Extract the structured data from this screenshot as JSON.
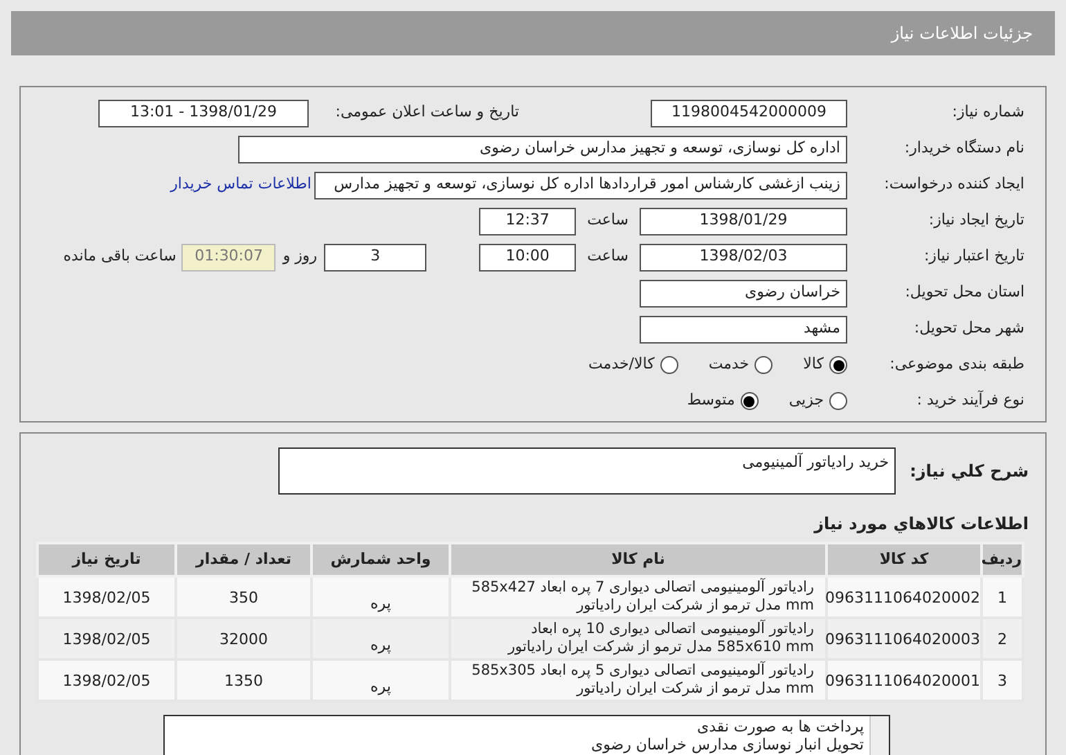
{
  "header": {
    "title": "جزئیات اطلاعات نیاز"
  },
  "need_number": {
    "label": "شماره نیاز:",
    "value": "1198004542000009"
  },
  "announce": {
    "label": "تاریخ و ساعت اعلان عمومی:",
    "value": "1398/01/29 - 13:01"
  },
  "buyer": {
    "label": "نام دستگاه خریدار:",
    "value": "اداره کل نوسازی، توسعه و تجهیز مدارس خراسان رضوی"
  },
  "creator": {
    "label": "ایجاد کننده درخواست:",
    "value": "زینب ازغشی کارشناس امور قراردادها اداره کل نوسازی، توسعه و تجهیز مدارس",
    "link": "اطلاعات تماس خریدار"
  },
  "created": {
    "label": "تاریخ ایجاد نیاز:",
    "date": "1398/01/29",
    "time_label": "ساعت",
    "time": "12:37"
  },
  "validity": {
    "label": "تاریخ اعتبار نیاز:",
    "date": "1398/02/03",
    "time_label": "ساعت",
    "time": "10:00",
    "days": "3",
    "days_label": "روز و",
    "remaining": "01:30:07",
    "remaining_label": "ساعت باقی مانده"
  },
  "province": {
    "label": "استان محل تحویل:",
    "value": "خراسان رضوی"
  },
  "city": {
    "label": "شهر محل تحویل:",
    "value": "مشهد"
  },
  "category": {
    "label": "طبقه بندی موضوعی:",
    "options": [
      {
        "label": "کالا",
        "selected": true
      },
      {
        "label": "خدمت",
        "selected": false
      },
      {
        "label": "کالا/خدمت",
        "selected": false
      }
    ]
  },
  "process": {
    "label": "نوع فرآیند خرید :",
    "options": [
      {
        "label": "جزیی",
        "selected": false
      },
      {
        "label": "متوسط",
        "selected": true
      }
    ]
  },
  "description": {
    "label": "شرح کلي نياز:",
    "value": "خرید رادیاتور آلمینیومی"
  },
  "items_heading": "اطلاعات کالاهاي مورد نياز",
  "table": {
    "columns": [
      "ردیف",
      "کد کالا",
      "نام کالا",
      "واحد شمارش",
      "تعداد / مقدار",
      "تاریخ نیاز"
    ],
    "rows": [
      [
        "1",
        "0963111064020002",
        "رادیاتور آلومینیومی اتصالی دیواری 7 پره ابعاد 585x427 mm مدل ترمو از شرکت ایران رادیاتور",
        "پره",
        "350",
        "1398/02/05"
      ],
      [
        "2",
        "0963111064020003",
        "رادیاتور آلومینیومی اتصالی دیواری 10 پره ابعاد 585x610 mm مدل ترمو از شرکت ایران رادیاتور",
        "پره",
        "32000",
        "1398/02/05"
      ],
      [
        "3",
        "0963111064020001",
        "رادیاتور آلومینیومی اتصالی دیواری 5 پره ابعاد 585x305 mm مدل ترمو از شرکت ایران رادیاتور",
        "پره",
        "1350",
        "1398/02/05"
      ]
    ]
  },
  "notes": [
    "پرداخت ها به صورت نقدی",
    "تحویل انبار نوسازی مدارس خراسان رضوی"
  ]
}
